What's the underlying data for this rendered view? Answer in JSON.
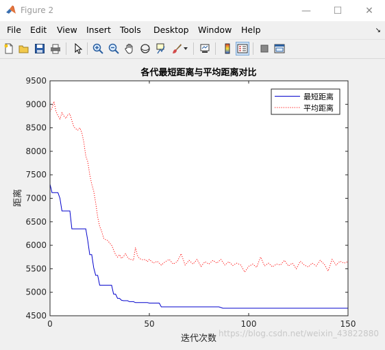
{
  "window": {
    "title": "Figure 2",
    "minimize": "—",
    "maximize": "☐",
    "close": "✕"
  },
  "menu": {
    "items": [
      "File",
      "Edit",
      "View",
      "Insert",
      "Tools",
      "Desktop",
      "Window",
      "Help"
    ],
    "overflow_arrow": "↘"
  },
  "toolbar": {
    "icons": [
      "new-figure-icon",
      "open-file-icon",
      "save-icon",
      "print-icon",
      "edit-plot-arrow-icon",
      "zoom-in-icon",
      "zoom-out-icon",
      "pan-hand-icon",
      "rotate-3d-icon",
      "data-cursor-icon",
      "brush-icon",
      "link-plot-icon",
      "colorbar-icon",
      "legend-icon",
      "hide-plot-tools-icon",
      "show-plot-tools-icon"
    ]
  },
  "colors": {
    "min_series": "#0000cc",
    "avg_series": "#ff0000"
  },
  "chart_data": {
    "type": "line",
    "title": "各代最短距离与平均距离对比",
    "xlabel": "迭代次数",
    "ylabel": "距离",
    "xlim": [
      0,
      150
    ],
    "ylim": [
      4500,
      9500
    ],
    "xticks": [
      0,
      50,
      100,
      150
    ],
    "yticks": [
      4500,
      5000,
      5500,
      6000,
      6500,
      7000,
      7500,
      8000,
      8500,
      9000,
      9500
    ],
    "grid": false,
    "legend_position": "top-right",
    "watermark": "https://blog.csdn.net/weixin_43822880",
    "series": [
      {
        "name": "最短距离",
        "color": "#0000cc",
        "style": "solid",
        "x": [
          0,
          1,
          2,
          3,
          4,
          5,
          6,
          7,
          8,
          9,
          10,
          11,
          12,
          13,
          14,
          15,
          16,
          17,
          18,
          19,
          20,
          21,
          22,
          23,
          24,
          25,
          26,
          27,
          28,
          29,
          30,
          31,
          32,
          33,
          34,
          35,
          36,
          37,
          38,
          39,
          40,
          41,
          42,
          43,
          44,
          45,
          46,
          47,
          48,
          49,
          50,
          51,
          52,
          53,
          54,
          55,
          56,
          60,
          70,
          80,
          85,
          87,
          90,
          100,
          110,
          120,
          130,
          140,
          150
        ],
        "values": [
          7300,
          7120,
          7120,
          7120,
          7120,
          7000,
          6730,
          6730,
          6730,
          6730,
          6730,
          6350,
          6350,
          6350,
          6350,
          6350,
          6350,
          6350,
          6350,
          6100,
          5800,
          5800,
          5520,
          5360,
          5360,
          5150,
          5150,
          5150,
          5150,
          5150,
          5150,
          5150,
          4960,
          4960,
          4870,
          4870,
          4830,
          4820,
          4820,
          4820,
          4800,
          4800,
          4800,
          4780,
          4780,
          4780,
          4780,
          4780,
          4780,
          4780,
          4770,
          4770,
          4770,
          4770,
          4770,
          4770,
          4690,
          4690,
          4690,
          4690,
          4690,
          4660,
          4660,
          4660,
          4660,
          4660,
          4660,
          4660,
          4660
        ]
      },
      {
        "name": "平均距离",
        "color": "#ff0000",
        "style": "dotted",
        "x": [
          0,
          1,
          2,
          3,
          4,
          5,
          6,
          7,
          8,
          9,
          10,
          11,
          12,
          13,
          14,
          15,
          16,
          17,
          18,
          19,
          20,
          21,
          22,
          23,
          24,
          25,
          26,
          27,
          28,
          29,
          30,
          31,
          32,
          33,
          34,
          35,
          36,
          37,
          38,
          39,
          40,
          41,
          42,
          43,
          44,
          45,
          46,
          47,
          48,
          49,
          50,
          52,
          54,
          56,
          58,
          60,
          62,
          64,
          66,
          68,
          70,
          72,
          74,
          76,
          78,
          80,
          82,
          84,
          86,
          88,
          90,
          92,
          94,
          96,
          98,
          100,
          102,
          104,
          106,
          108,
          110,
          112,
          114,
          116,
          118,
          120,
          122,
          124,
          126,
          128,
          130,
          132,
          134,
          136,
          138,
          140,
          142,
          144,
          146,
          148,
          150
        ],
        "values": [
          8850,
          8920,
          9060,
          8850,
          8760,
          8690,
          8820,
          8750,
          8700,
          8780,
          8800,
          8650,
          8520,
          8480,
          8450,
          8500,
          8400,
          8200,
          7900,
          7780,
          7500,
          7300,
          7150,
          6900,
          6600,
          6400,
          6300,
          6150,
          6120,
          6100,
          6050,
          6000,
          5900,
          5800,
          5750,
          5800,
          5720,
          5760,
          5820,
          5750,
          5700,
          5700,
          5680,
          5950,
          5780,
          5720,
          5700,
          5690,
          5700,
          5650,
          5700,
          5620,
          5660,
          5580,
          5650,
          5700,
          5600,
          5650,
          5820,
          5580,
          5680,
          5600,
          5700,
          5550,
          5650,
          5600,
          5680,
          5620,
          5700,
          5580,
          5650,
          5570,
          5620,
          5580,
          5430,
          5550,
          5600,
          5530,
          5750,
          5560,
          5620,
          5540,
          5600,
          5580,
          5680,
          5560,
          5620,
          5500,
          5660,
          5580,
          5540,
          5620,
          5560,
          5680,
          5600,
          5450,
          5700,
          5580,
          5660,
          5620,
          5650
        ]
      }
    ]
  }
}
